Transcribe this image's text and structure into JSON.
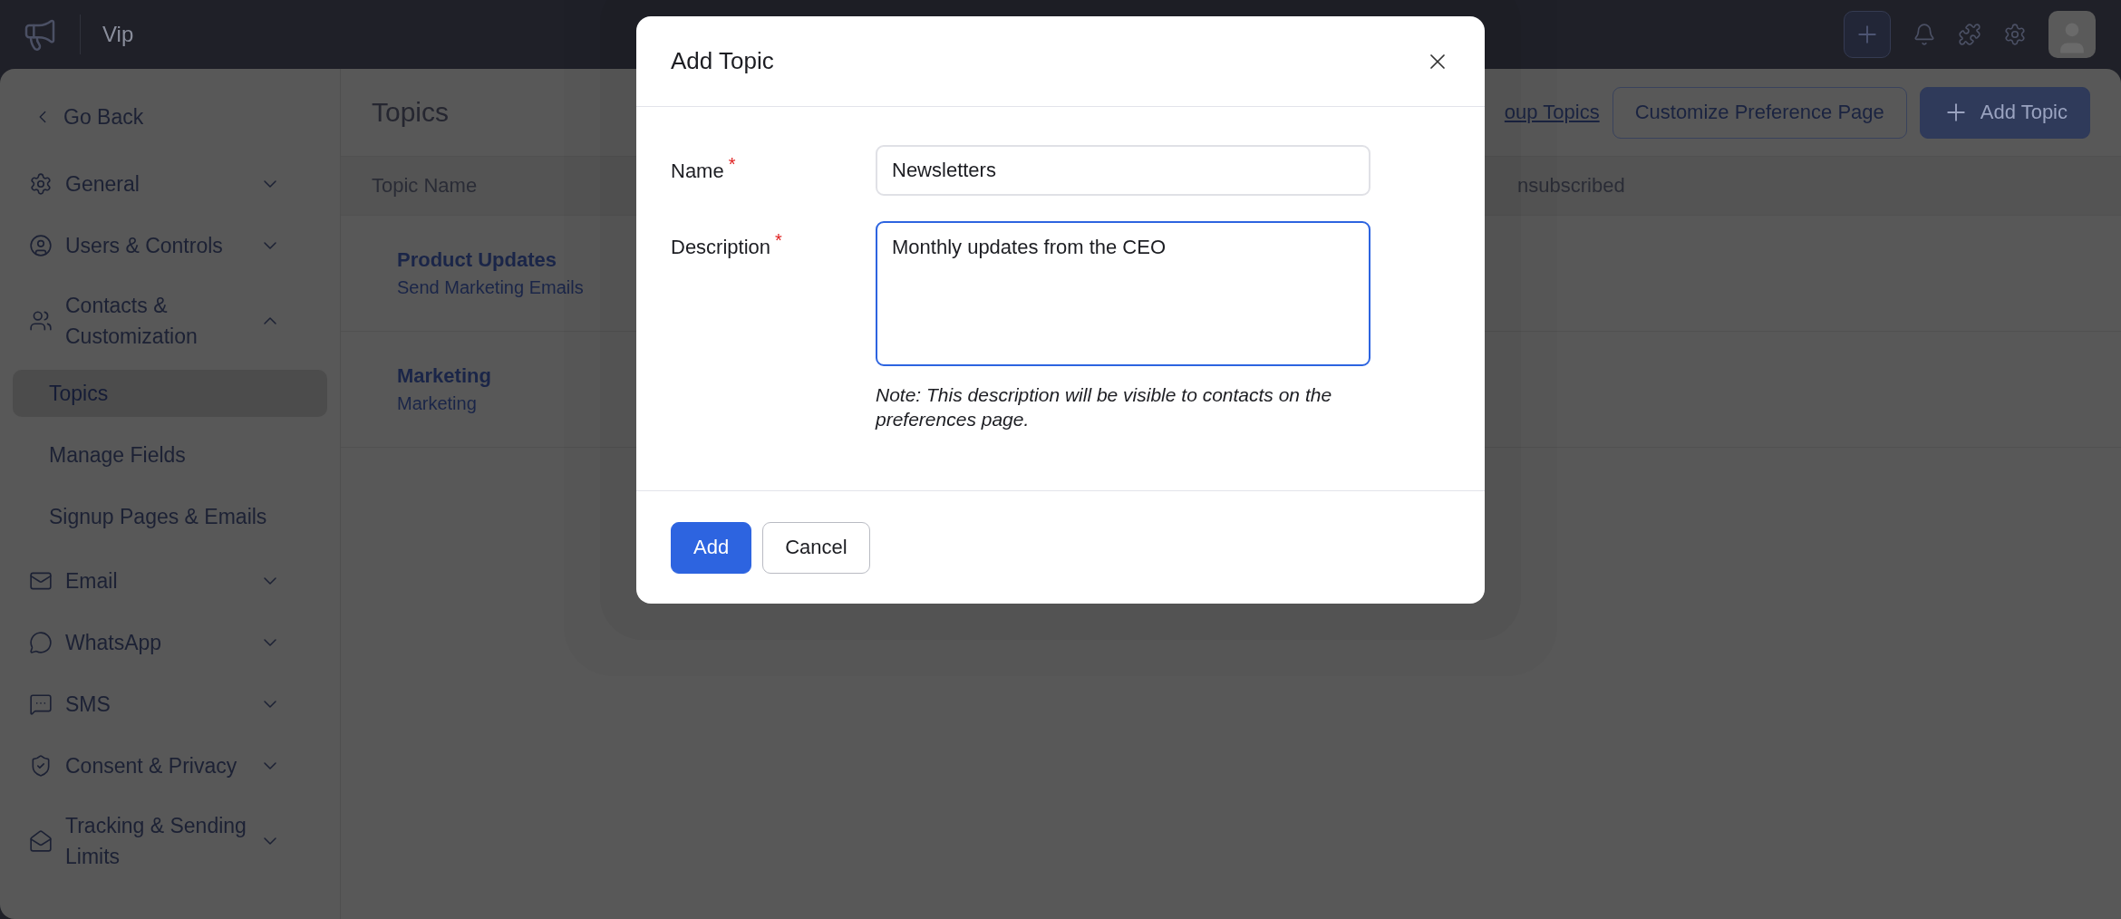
{
  "top_bar": {
    "workspace": "Vip"
  },
  "sidebar": {
    "back": "Go Back",
    "items": [
      {
        "label": "General",
        "expanded": false
      },
      {
        "label": "Users & Controls",
        "expanded": false
      },
      {
        "label": "Contacts & Customization",
        "expanded": true,
        "children": [
          {
            "label": "Topics",
            "selected": true
          },
          {
            "label": "Manage Fields",
            "selected": false
          },
          {
            "label": "Signup Pages & Emails",
            "selected": false
          }
        ]
      },
      {
        "label": "Email",
        "expanded": false
      },
      {
        "label": "WhatsApp",
        "expanded": false
      },
      {
        "label": "SMS",
        "expanded": false
      },
      {
        "label": "Consent & Privacy",
        "expanded": false
      },
      {
        "label": "Tracking & Sending Limits",
        "expanded": false
      }
    ]
  },
  "main": {
    "title": "Topics",
    "link": "oup Topics",
    "buttons": [
      {
        "label": "Customize Preference Page",
        "kind": "outline"
      },
      {
        "label": "Add Topic",
        "kind": "primary"
      }
    ],
    "table": {
      "columns": [
        "Topic Name",
        "nsubscribed"
      ],
      "rows": [
        {
          "name": "Product Updates",
          "description": "Send Marketing Emails"
        },
        {
          "name": "Marketing",
          "description": "Marketing"
        }
      ]
    }
  },
  "dialog": {
    "title": "Add Topic",
    "fields": [
      {
        "label": "Name",
        "required_mark": "*",
        "kind": "input",
        "value": "Newsletters",
        "focused": false
      },
      {
        "label": "Description",
        "required_mark": "*",
        "kind": "textarea",
        "value": "Monthly updates from the CEO",
        "focused": true
      }
    ],
    "note": "Note: This description will be visible to contacts on the preferences page.",
    "buttons": [
      {
        "label": "Add",
        "kind": "primary"
      },
      {
        "label": "Cancel",
        "kind": "secondary"
      }
    ]
  }
}
